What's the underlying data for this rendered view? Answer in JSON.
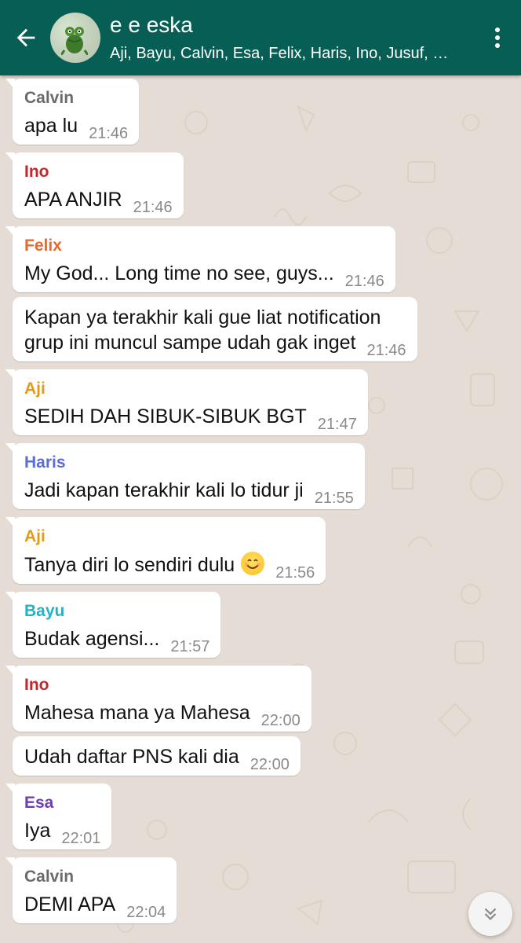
{
  "header": {
    "title": "e e eska",
    "subtitle": "Aji, Bayu, Calvin, Esa, Felix, Haris, Ino, Jusuf, Mahesa",
    "back_icon": "arrow-left-icon",
    "menu_icon": "more-vertical-icon",
    "background": "#075e54"
  },
  "messages": [
    {
      "sender": "Calvin",
      "color": "#6b6b6b",
      "text": "apa lu",
      "time": "21:46"
    },
    {
      "sender": "Ino",
      "color": "#c1272d",
      "text": "APA ANJIR",
      "time": "21:46"
    },
    {
      "sender": "Felix",
      "color": "#e8692b",
      "text": "My God... Long time no see, guys...",
      "time": "21:46"
    },
    {
      "sender": "",
      "color": "",
      "text": "Kapan ya terakhir kali gue liat notification grup ini muncul sampe udah gak inget",
      "time": "21:46"
    },
    {
      "sender": "Aji",
      "color": "#e29a17",
      "text": "SEDIH DAH SIBUK-SIBUK BGT",
      "time": "21:47"
    },
    {
      "sender": "Haris",
      "color": "#5b6ed6",
      "text": "Jadi kapan terakhir kali lo tidur ji",
      "time": "21:55"
    },
    {
      "sender": "Aji",
      "color": "#e29a17",
      "text": "Tanya diri lo sendiri dulu",
      "time": "21:56",
      "emoji": "smiling-face-emoji"
    },
    {
      "sender": "Bayu",
      "color": "#1fb5c4",
      "text": "Budak agensi...",
      "time": "21:57"
    },
    {
      "sender": "Ino",
      "color": "#c1272d",
      "text": "Mahesa mana ya Mahesa",
      "time": "22:00"
    },
    {
      "sender": "",
      "color": "",
      "text": "Udah daftar PNS kali dia",
      "time": "22:00"
    },
    {
      "sender": "Esa",
      "color": "#6f3eb0",
      "text": "Iya",
      "time": "22:01"
    },
    {
      "sender": "Calvin",
      "color": "#6b6b6b",
      "text": "DEMI APA",
      "time": "22:04"
    }
  ],
  "scroll_button_icon": "double-chevron-down-icon"
}
